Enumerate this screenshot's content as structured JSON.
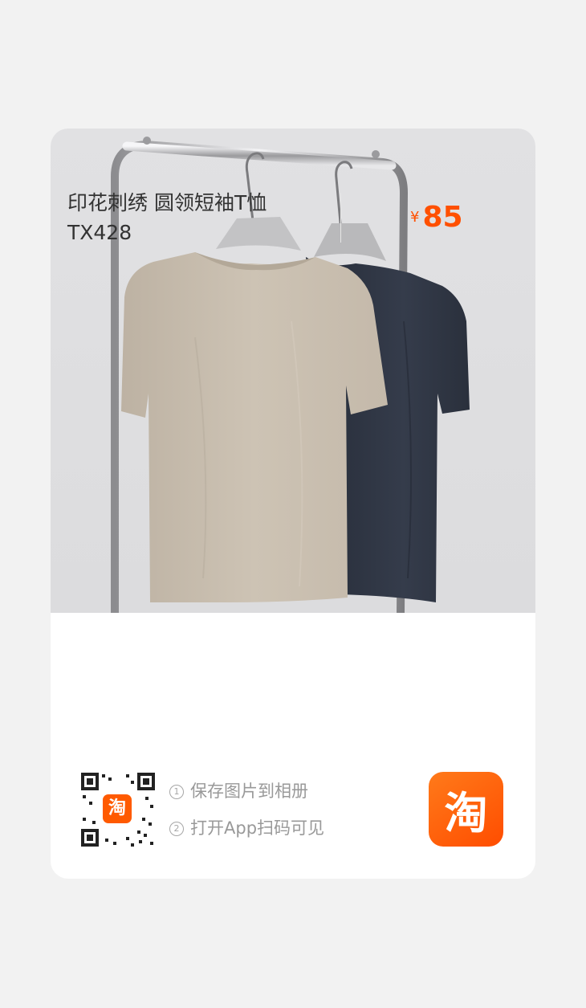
{
  "product": {
    "title": "印花刺绣 圆领短袖T恤 TX428",
    "currency": "¥",
    "price": "85"
  },
  "share": {
    "qr_badge": "淘",
    "steps": [
      {
        "index": "1",
        "text": "保存图片到相册"
      },
      {
        "index": "2",
        "text": "打开App扫码可见"
      }
    ],
    "app_logo": "淘"
  },
  "colors": {
    "accent": "#ff5000",
    "beige_shirt": "#c9bfb0",
    "navy_shirt": "#2e3441",
    "background": "#f2f2f2"
  },
  "icons": [
    "qr-code-icon",
    "taobao-logo-icon"
  ]
}
